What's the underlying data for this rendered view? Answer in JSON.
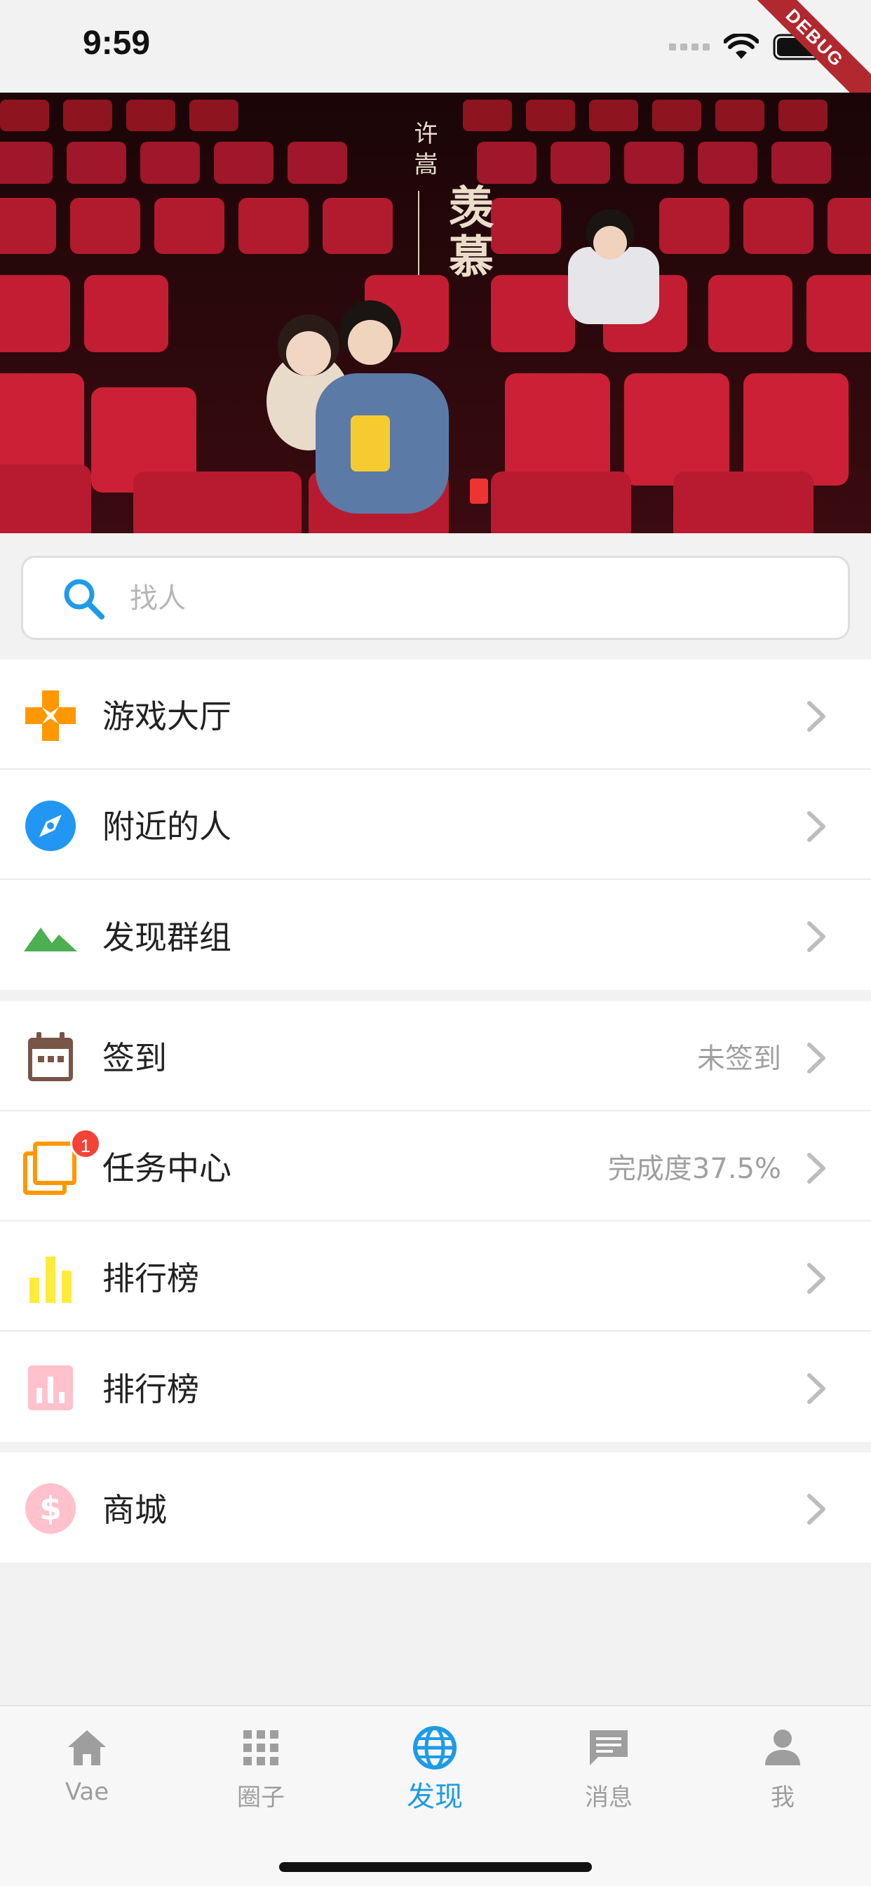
{
  "status_bar": {
    "time": "9:59",
    "debug_label": "DEBUG"
  },
  "banner": {
    "artist": "许嵩",
    "title": "羡慕"
  },
  "search": {
    "placeholder": "找人"
  },
  "groups": [
    {
      "items": [
        {
          "label": "游戏大厅",
          "icon": "gamepad-icon",
          "color": "#ff9800"
        },
        {
          "label": "附近的人",
          "icon": "compass-icon",
          "color": "#2196f3"
        },
        {
          "label": "发现群组",
          "icon": "landscape-icon",
          "color": "#4caf50"
        }
      ]
    },
    {
      "items": [
        {
          "label": "签到",
          "value": "未签到",
          "icon": "calendar-icon",
          "color": "#795548"
        },
        {
          "label": "任务中心",
          "value": "完成度37.5%",
          "icon": "tasks-icon",
          "color": "#ff9800",
          "badge": "1"
        },
        {
          "label": "排行榜",
          "icon": "bar-chart-icon",
          "color": "#ffeb3b"
        },
        {
          "label": "排行榜",
          "icon": "chart-box-icon",
          "color": "#ffc1cc"
        }
      ]
    },
    {
      "items": [
        {
          "label": "商城",
          "icon": "dollar-icon",
          "color": "#ffc1cc"
        }
      ]
    }
  ],
  "bottom_nav": [
    {
      "label": "Vae",
      "icon": "home-icon",
      "active": false
    },
    {
      "label": "圈子",
      "icon": "grid-icon",
      "active": false
    },
    {
      "label": "发现",
      "icon": "globe-icon",
      "active": true
    },
    {
      "label": "消息",
      "icon": "message-icon",
      "active": false
    },
    {
      "label": "我",
      "icon": "person-icon",
      "active": false
    }
  ],
  "colors": {
    "accent": "#1e9be6",
    "badge": "#f44336"
  }
}
